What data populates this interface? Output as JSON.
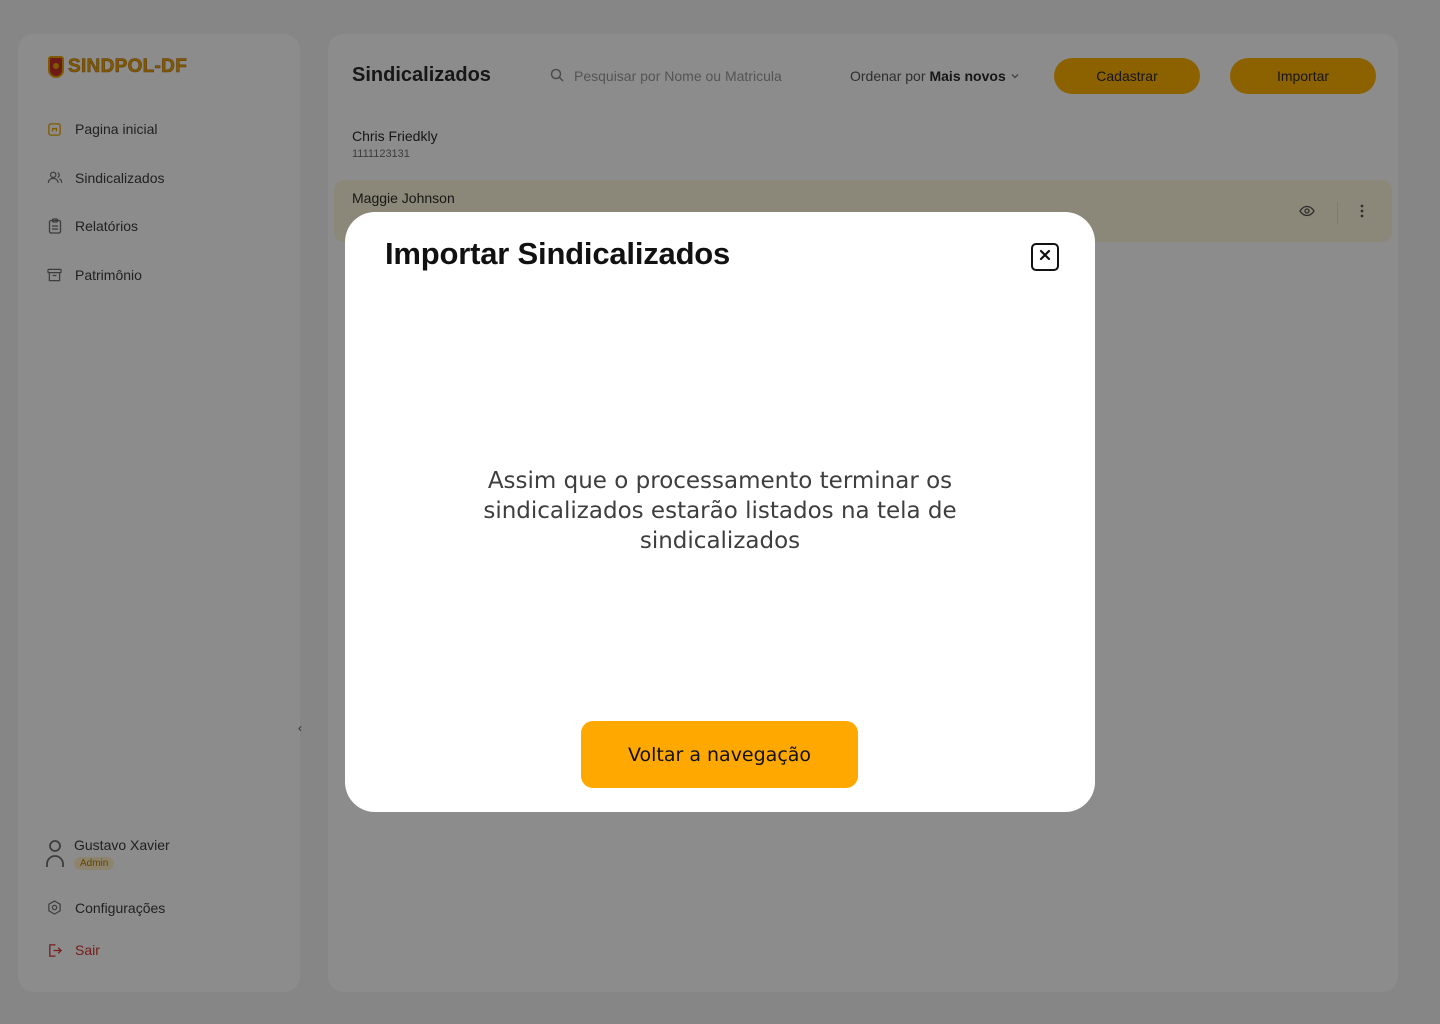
{
  "sidebar": {
    "logo_text": "SINDPOL-DF",
    "items": [
      {
        "label": "Pagina inicial",
        "icon": "home-icon"
      },
      {
        "label": "Sindicalizados",
        "icon": "users-icon"
      },
      {
        "label": "Relatórios",
        "icon": "clipboard-icon"
      },
      {
        "label": "Patrimônio",
        "icon": "archive-icon"
      }
    ],
    "user": {
      "name": "Gustavo Xavier",
      "role": "Admin"
    },
    "settings_label": "Configurações",
    "logout_label": "Sair"
  },
  "main": {
    "title": "Sindicalizados",
    "search_placeholder": "Pesquisar por Nome ou Matricula",
    "sort_prefix": "Ordenar por",
    "sort_value": "Mais novos",
    "cadastrar_label": "Cadastrar",
    "importar_label": "Importar",
    "rows": [
      {
        "name": "Chris Friedkly",
        "id": "1111123131"
      },
      {
        "name": "Maggie Johnson",
        "id": ""
      }
    ]
  },
  "modal": {
    "title": "Importar Sindicalizados",
    "message": "Assim que o processamento terminar os sindicalizados estarão listados na tela de sindicalizados",
    "button_label": "Voltar a navegação"
  },
  "colors": {
    "accent": "#ffa800",
    "overlay": "rgba(0,0,0,0.45)",
    "logout": "#dd3333"
  }
}
